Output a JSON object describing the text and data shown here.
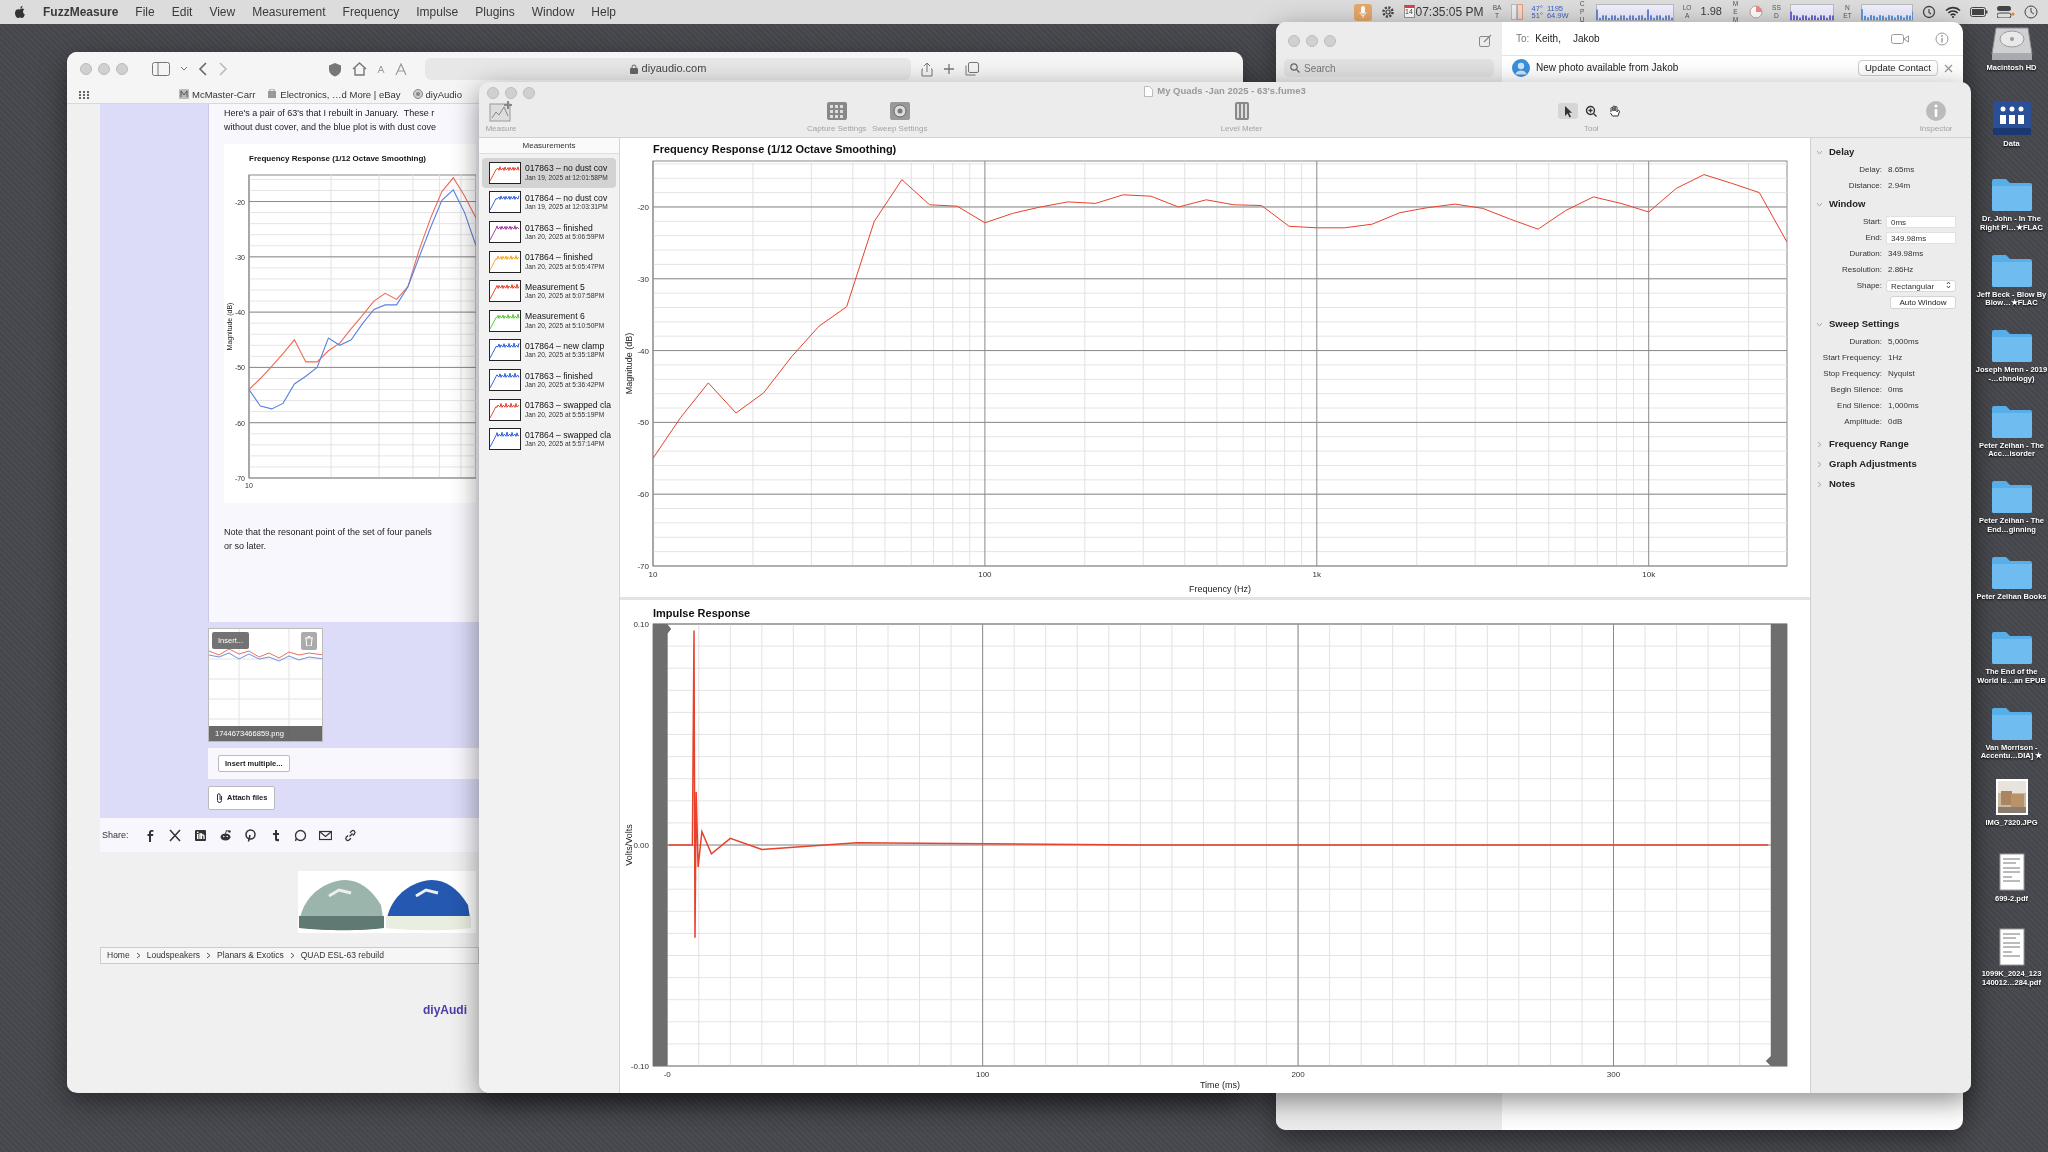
{
  "menu_bar": {
    "app": "FuzzMeasure",
    "menus": [
      "File",
      "Edit",
      "View",
      "Measurement",
      "Frequency",
      "Impulse",
      "Plugins",
      "Window",
      "Help"
    ],
    "status": {
      "calendar_day": "14",
      "clock": "07:35:05 PM",
      "bat_label": "BAT",
      "temps": [
        "47°",
        "51°"
      ],
      "stats": [
        "1195",
        "64.9W"
      ],
      "cpu_label": "CPU",
      "load_label": "LOA",
      "load": "1.98",
      "mem_label": "MEM",
      "ssd_label": "SSD",
      "net_label": "NET"
    }
  },
  "browser": {
    "address": "diyaudio.com",
    "bookmarks": [
      "McMaster-Carr",
      "Electronics, …d More | eBay",
      "diyAudio"
    ],
    "post": {
      "lines": [
        "Here's a pair of 63's that I rebuilt in January.  These r",
        "without dust cover, and the blue plot is with dust cove"
      ],
      "chart_data": {
        "type": "line",
        "title": "Frequency Response (1/12 Octave Smoothing)",
        "ylabel": "Magnitude (dB)",
        "categories": [
          "10",
          null,
          null,
          null,
          null,
          null,
          null,
          null,
          null,
          null,
          null,
          null,
          null,
          null,
          null,
          null,
          null,
          null,
          null,
          null,
          null
        ],
        "series": [
          {
            "color": "#ef6a55",
            "values": [
              -54,
              -52,
              -49.8,
              -47.5,
              -45,
              -49,
              -49,
              -47,
              -45.6,
              -43,
              -40.6,
              -38,
              -36.6,
              -37.7,
              -35.4,
              -28.7,
              -23,
              -18.2,
              -15.7,
              -19,
              -23
            ]
          },
          {
            "color": "#5a80e0",
            "values": [
              -54,
              -57,
              -57.5,
              -56.5,
              -53,
              -51.6,
              -50,
              -44.7,
              -46,
              -45,
              -42.1,
              -39.5,
              -38.7,
              -38.7,
              -35.4,
              -30,
              -24.7,
              -19.8,
              -17.9,
              -22,
              -28
            ]
          }
        ],
        "grid": true,
        "ylim": [
          -70,
          -15.2
        ],
        "yticks": [
          -20,
          -30,
          -40,
          -50,
          -60,
          -70
        ]
      },
      "note_lines": [
        "Note that the resonant point of the set of four panels",
        "or so later."
      ]
    },
    "attachment": {
      "overlay_button": "Insert...",
      "filename": "1744673466859.png"
    },
    "insert_multiple": "Insert multiple...",
    "attach_files": "Attach files",
    "share_label": "Share:",
    "breadcrumb": [
      "Home",
      "Loudspeakers",
      "Planars & Exotics",
      "QUAD ESL-63 rebuild"
    ],
    "footer_logo": "diyAudi"
  },
  "messages": {
    "search_placeholder": "Search",
    "to_label": "To:",
    "recipients": [
      "Keith,",
      "Jakob"
    ],
    "banner": {
      "text": "New photo available from Jakob",
      "button": "Update Contact"
    }
  },
  "fuzzmeasure": {
    "title": "My Quads -Jan 2025 - 63's.fume3",
    "toolbar": [
      {
        "kind": "measure",
        "label": "Measure"
      },
      {
        "kind": "capture",
        "label": "Capture Settings"
      },
      {
        "kind": "sweep",
        "label": "Sweep Settings"
      },
      {
        "kind": "meter",
        "label": "Level Meter"
      },
      {
        "kind": "tools",
        "label": "Tool",
        "options": [
          {
            "kind": "pointer",
            "selected": true
          },
          {
            "kind": "zoom",
            "selected": false
          },
          {
            "kind": "hand",
            "selected": false
          }
        ]
      },
      {
        "kind": "inspector",
        "label": "Inspector"
      }
    ],
    "sidebar": {
      "header": "Measurements",
      "items": [
        {
          "name": "017863 – no dust cov",
          "date": "Jan 19, 2025 at 12:01:58PM",
          "color": "#e8412c",
          "selected": true
        },
        {
          "name": "017864 – no dust cov",
          "date": "Jan 19, 2025 at 12:03:31PM",
          "color": "#2f5fe0",
          "selected": false
        },
        {
          "name": "017863 – finished",
          "date": "Jan 20, 2025 at 5:06:59PM",
          "color": "#a03a9a",
          "selected": false
        },
        {
          "name": "017864 – finished",
          "date": "Jan 20, 2025 at 5:05:47PM",
          "color": "#f5a623",
          "selected": false
        },
        {
          "name": "Measurement 5",
          "date": "Jan 20, 2025 at 5:07:58PM",
          "color": "#e8412c",
          "selected": false
        },
        {
          "name": "Measurement 6",
          "date": "Jan 20, 2025 at 5:10:50PM",
          "color": "#5ac83a",
          "selected": false
        },
        {
          "name": "017864 – new clamp",
          "date": "Jan 20, 2025 at 5:35:18PM",
          "color": "#2f5fe0",
          "selected": false
        },
        {
          "name": "017863 – finished",
          "date": "Jan 20, 2025 at 5:36:42PM",
          "color": "#2f5fe0",
          "selected": false
        },
        {
          "name": "017863 – swapped cla",
          "date": "Jan 20, 2025 at 5:55:19PM",
          "color": "#e8412c",
          "selected": false
        },
        {
          "name": "017864 – swapped cla",
          "date": "Jan 20, 2025 at 5:57:14PM",
          "color": "#2f5fe0",
          "selected": false
        }
      ]
    },
    "frequency_chart": {
      "chart_data": {
        "type": "line",
        "title": "Frequency Response (1/12 Octave Smoothing)",
        "xlabel": "Frequency (Hz)",
        "ylabel": "Magnitude (dB)",
        "categories": [
          "10",
          null,
          null,
          null,
          null,
          null,
          null,
          null,
          null,
          null,
          null,
          null,
          "100",
          null,
          null,
          null,
          null,
          null,
          null,
          null,
          null,
          null,
          null,
          null,
          "1k",
          null,
          null,
          null,
          null,
          null,
          null,
          null,
          null,
          null,
          null,
          null,
          "10k",
          null,
          null,
          null,
          null,
          null
        ],
        "series": [
          {
            "color": "#e8412c",
            "values": [
              -55,
              -49.3,
              -44.5,
              -48.7,
              -45.9,
              -40.9,
              -36.6,
              -33.9,
              -22,
              -16.2,
              -19.7,
              -19.9,
              -22.2,
              -20.9,
              -20,
              -19.3,
              -19.5,
              -18.3,
              -18.5,
              -20,
              -19,
              -19.7,
              -19.8,
              -22.7,
              -22.9,
              -22.9,
              -22.4,
              -20.8,
              -20.1,
              -19.6,
              -20.2,
              -21.7,
              -23.1,
              -20.5,
              -18.6,
              -19.5,
              -20.7,
              -17.4,
              -15.5,
              -16.7,
              -18,
              -24.9
            ]
          }
        ],
        "grid": true,
        "ylim": [
          -70,
          -13.6
        ],
        "yticks": [
          -20,
          -30,
          -40,
          -50,
          -60,
          -70
        ]
      }
    },
    "impulse_chart": {
      "chart_data": {
        "type": "line",
        "title": "Impulse Response",
        "xlabel": "Time (ms)",
        "ylabel": "Volts/Volts",
        "x": [
          0.4,
          8,
          8.5,
          8.8,
          9.2,
          9.8,
          11,
          14,
          20,
          30,
          60,
          150,
          349
        ],
        "series": [
          {
            "color": "#e8412c",
            "values": [
              0,
              0,
              0.097,
              -0.042,
              0.024,
              -0.01,
              0.006,
              -0.004,
              0.003,
              -0.002,
              0.001,
              0,
              0
            ]
          }
        ],
        "grid": true,
        "xlim": [
          -4.5,
          355
        ],
        "ylim": [
          -0.1,
          0.1
        ],
        "xticks": [
          {
            "value": 0,
            "label": "-0"
          },
          100,
          200,
          300
        ],
        "yticks": [
          {
            "value": 0.1,
            "label": "0.10"
          },
          {
            "value": 0,
            "label": "0.00"
          },
          {
            "value": -0.1,
            "label": "-0.10"
          }
        ]
      }
    },
    "inspector": {
      "sections": [
        {
          "title": "Delay",
          "expanded": true,
          "rows": [
            {
              "kind": "value",
              "label": "Delay:",
              "value": "8.65ms"
            },
            {
              "kind": "value",
              "label": "Distance:",
              "value": "2.94m"
            }
          ]
        },
        {
          "title": "Window",
          "expanded": true,
          "rows": [
            {
              "kind": "field",
              "label": "Start:",
              "value": "0ms"
            },
            {
              "kind": "field",
              "label": "End:",
              "value": "349.98ms"
            },
            {
              "kind": "value",
              "label": "Duration:",
              "value": "349.98ms"
            },
            {
              "kind": "value",
              "label": "Resolution:",
              "value": "2.86Hz"
            },
            {
              "kind": "select",
              "label": "Shape:",
              "value": "Rectangular"
            },
            {
              "kind": "button",
              "value": "Auto Window"
            }
          ]
        },
        {
          "title": "Sweep Settings",
          "expanded": true,
          "rows": [
            {
              "kind": "value",
              "label": "Duration:",
              "value": "5,000ms"
            },
            {
              "kind": "value",
              "label": "Start Frequency:",
              "value": "1Hz"
            },
            {
              "kind": "value",
              "label": "Stop Frequency:",
              "value": "Nyquist"
            },
            {
              "kind": "value",
              "label": "Begin Silence:",
              "value": "0ms"
            },
            {
              "kind": "value",
              "label": "End Silence:",
              "value": "1,000ms"
            },
            {
              "kind": "value",
              "label": "Amplitude:",
              "value": "0dB"
            }
          ]
        },
        {
          "title": "Frequency Range",
          "expanded": false
        },
        {
          "title": "Graph Adjustments",
          "expanded": false
        },
        {
          "title": "Notes",
          "expanded": false
        }
      ]
    }
  },
  "desktop_icons": [
    {
      "label": "Macintosh HD",
      "kind": "drive"
    },
    {
      "label": "Data",
      "kind": "network-drive"
    },
    {
      "label": "Dr. John - In The Right Pl…★FLAC",
      "kind": "folder"
    },
    {
      "label": "Jeff Beck - Blow By Blow…★FLAC",
      "kind": "folder"
    },
    {
      "label": "Joseph Menn - 2019 -…chnology)",
      "kind": "folder"
    },
    {
      "label": "Peter Zeihan - The Acc…isorder",
      "kind": "folder"
    },
    {
      "label": "Peter Zeihan - The End…ginning",
      "kind": "folder"
    },
    {
      "label": "Peter Zeihan Books",
      "kind": "folder"
    },
    {
      "label": "The End of the World Is…an EPUB",
      "kind": "folder"
    },
    {
      "label": "Van Morrison - Accentu…DIA] ★",
      "kind": "folder"
    },
    {
      "label": "IMG_7320.JPG"
    },
    {
      "label": "699-2.pdf",
      "kind": "pdf"
    },
    {
      "label": "1099K_2024_123 140012…284.pdf",
      "kind": "pdf"
    }
  ]
}
